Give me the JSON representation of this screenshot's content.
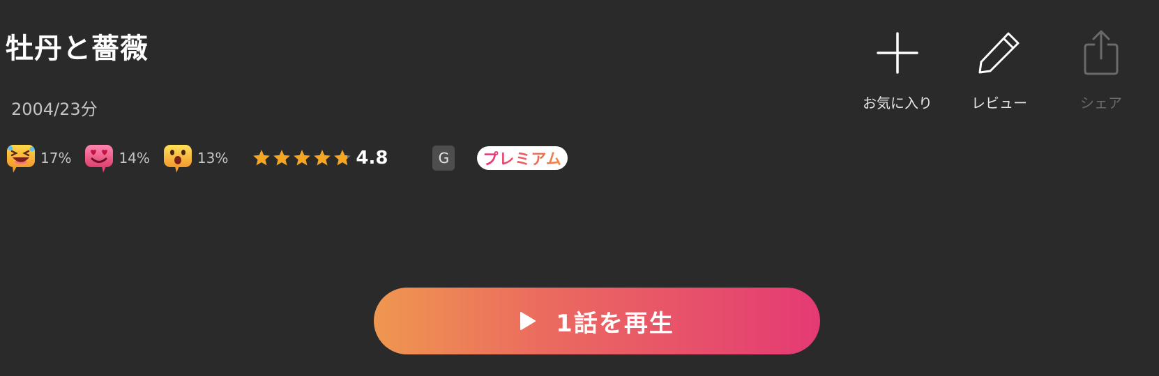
{
  "title": "牡丹と薔薇",
  "meta": "2004/23分",
  "reactions": [
    {
      "icon": "laughing-face-icon",
      "percent": "17%"
    },
    {
      "icon": "heart-eyes-face-icon",
      "percent": "14%"
    },
    {
      "icon": "surprised-face-icon",
      "percent": "13%"
    }
  ],
  "rating": {
    "value": "4.8",
    "stars_filled": 4.8,
    "stars_total": 5,
    "star_icon": "star-icon"
  },
  "age_rating": "G",
  "premium_badge": "プレミアム",
  "actions": [
    {
      "icon": "plus-icon",
      "label": "お気に入り",
      "enabled": true
    },
    {
      "icon": "pencil-icon",
      "label": "レビュー",
      "enabled": true
    },
    {
      "icon": "share-icon",
      "label": "シェア",
      "enabled": false
    }
  ],
  "play_button": {
    "icon": "play-icon",
    "label": "1話を再生"
  },
  "colors": {
    "background": "#2a2a2a",
    "play_gradient_start": "#ef9750",
    "play_gradient_end": "#e43a74",
    "premium_pink": "#e52d79",
    "premium_orange": "#ef8a45",
    "star": "#f5a623"
  }
}
